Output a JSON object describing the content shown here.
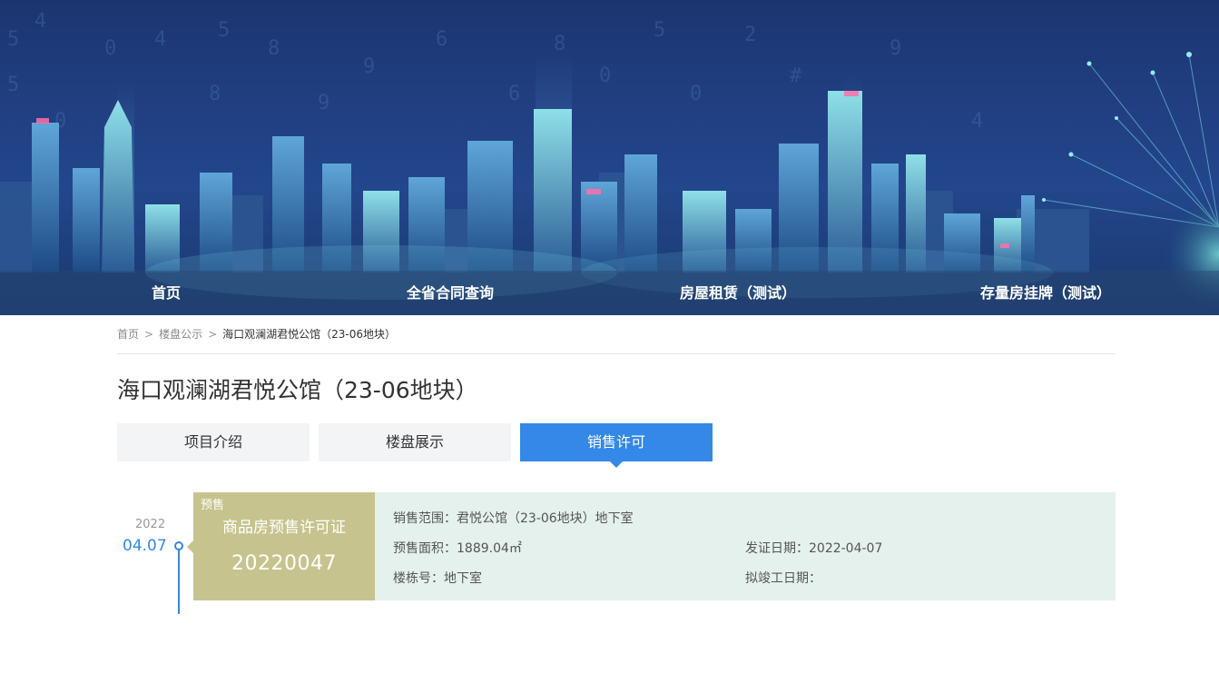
{
  "nav": {
    "items": [
      {
        "label": "首页"
      },
      {
        "label": "全省合同查询"
      },
      {
        "label": "房屋租赁（测试）"
      },
      {
        "label": "存量房挂牌（测试）"
      }
    ]
  },
  "breadcrumb": {
    "home": "首页",
    "separator": ">",
    "section": "楼盘公示",
    "current": "海口观澜湖君悦公馆（23-06地块）"
  },
  "page_title": "海口观澜湖君悦公馆（23-06地块）",
  "tabs": [
    {
      "label": "项目介绍",
      "active": false
    },
    {
      "label": "楼盘展示",
      "active": false
    },
    {
      "label": "销售许可",
      "active": true
    }
  ],
  "permits": [
    {
      "year": "2022",
      "date": "04.07",
      "tag": "预售",
      "permit_type": "商品房预售许可证",
      "permit_number": "20220047",
      "sales_scope": "销售范围：君悦公馆（23-06地块）地下室",
      "presale_area": "预售面积：1889.04㎡",
      "issue_date": "发证日期：2022-04-07",
      "building_no": "楼栋号：地下室",
      "completion_date": "拟竣工日期："
    }
  ],
  "colors": {
    "accent": "#3388e8",
    "permit_tag_bg": "#c7c38e",
    "permit_info_bg": "#e4f1ec",
    "banner_bg": "#1e3f7c"
  }
}
